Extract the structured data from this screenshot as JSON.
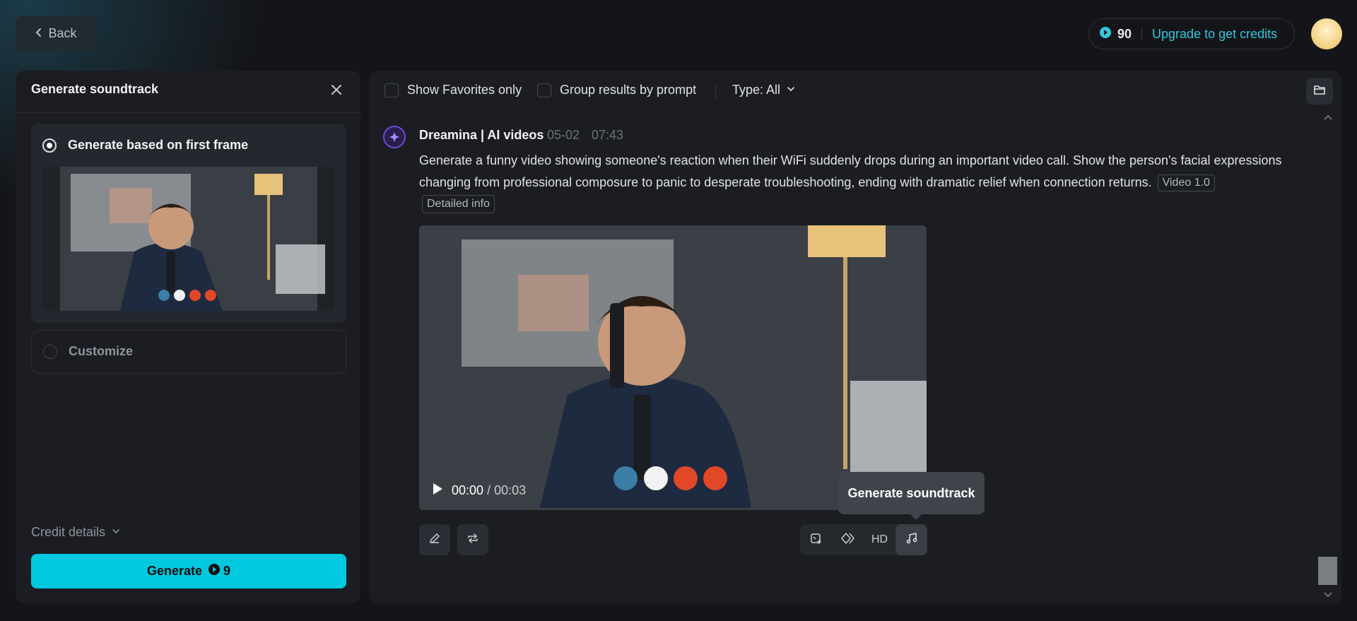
{
  "header": {
    "back_label": "Back",
    "credits": "90",
    "upgrade_label": "Upgrade to get credits"
  },
  "left_panel": {
    "title": "Generate soundtrack",
    "option_first_frame": "Generate based on first frame",
    "option_customize": "Customize",
    "credit_details": "Credit details",
    "generate_label": "Generate",
    "generate_cost": "9"
  },
  "filters": {
    "favorites": "Show Favorites only",
    "group": "Group results by prompt",
    "type": "Type: All"
  },
  "post": {
    "author": "Dreamina | AI videos",
    "date": "05-02",
    "time": "07:43",
    "prompt": "Generate a funny video showing someone's reaction when their WiFi suddenly drops during an important video call. Show the person's facial expressions changing from professional composure to panic to desperate troubleshooting, ending with dramatic relief when connection returns.",
    "model_tag": "Video 1.0",
    "detail_tag": "Detailed info"
  },
  "video": {
    "current_time": "00:00",
    "separator": "/",
    "duration": "00:03"
  },
  "toolbar": {
    "hd_label": "HD",
    "tooltip": "Generate soundtrack"
  },
  "colors": {
    "accent": "#00c8de",
    "upgrade_text": "#33c8e0",
    "background": "#141518",
    "panel": "#1b1d22"
  },
  "icons": {
    "back": "chevron-left-icon",
    "credits": "credit-coin-icon",
    "close": "close-icon",
    "dropdown": "chevron-down-icon",
    "folder": "folder-icon",
    "play": "play-icon",
    "edit": "pencil-icon",
    "regenerate": "repeat-icon",
    "upscale": "image-plus-icon",
    "interpolate": "diamond-icon",
    "soundtrack": "music-note-icon"
  }
}
